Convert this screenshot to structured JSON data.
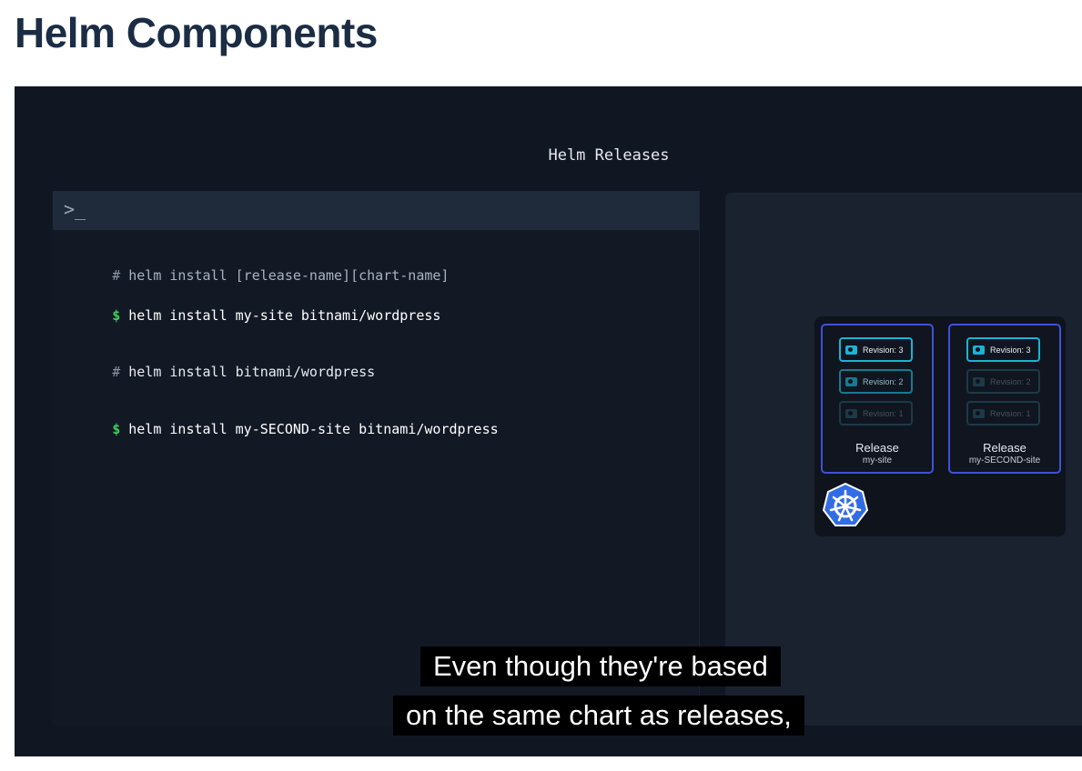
{
  "page": {
    "title": "Helm Components"
  },
  "video": {
    "scene_title": "Helm Releases",
    "terminal": {
      "prompt_icon": ">_",
      "lines": [
        {
          "symbol": "#",
          "text": "helm install [release-name][chart-name]"
        },
        {
          "symbol": "$",
          "text": "helm install my-site bitnami/wordpress"
        },
        {
          "symbol": "#",
          "text": "helm install bitnami/wordpress"
        },
        {
          "symbol": "$",
          "text": "helm install my-SECOND-site bitnami/wordpress"
        }
      ]
    },
    "cluster": {
      "icon": "kubernetes-helm-wheel-icon",
      "releases": [
        {
          "label": "Release",
          "name": "my-site",
          "revisions": [
            "Revision: 3",
            "Revision: 2",
            "Revision: 1"
          ]
        },
        {
          "label": "Release",
          "name": "my-SECOND-site",
          "revisions": [
            "Revision: 3",
            "Revision: 2",
            "Revision: 1"
          ]
        }
      ]
    },
    "captions": [
      "Even though they're based",
      "on the same chart as releases,"
    ]
  },
  "colors": {
    "title": "#1b2d44",
    "video_bg": "#111722",
    "prompt_dollar": "#3ecf5a",
    "release_border": "#3f52d6",
    "revision_accent": "#19b4d6",
    "k8s_blue": "#326ce5"
  }
}
